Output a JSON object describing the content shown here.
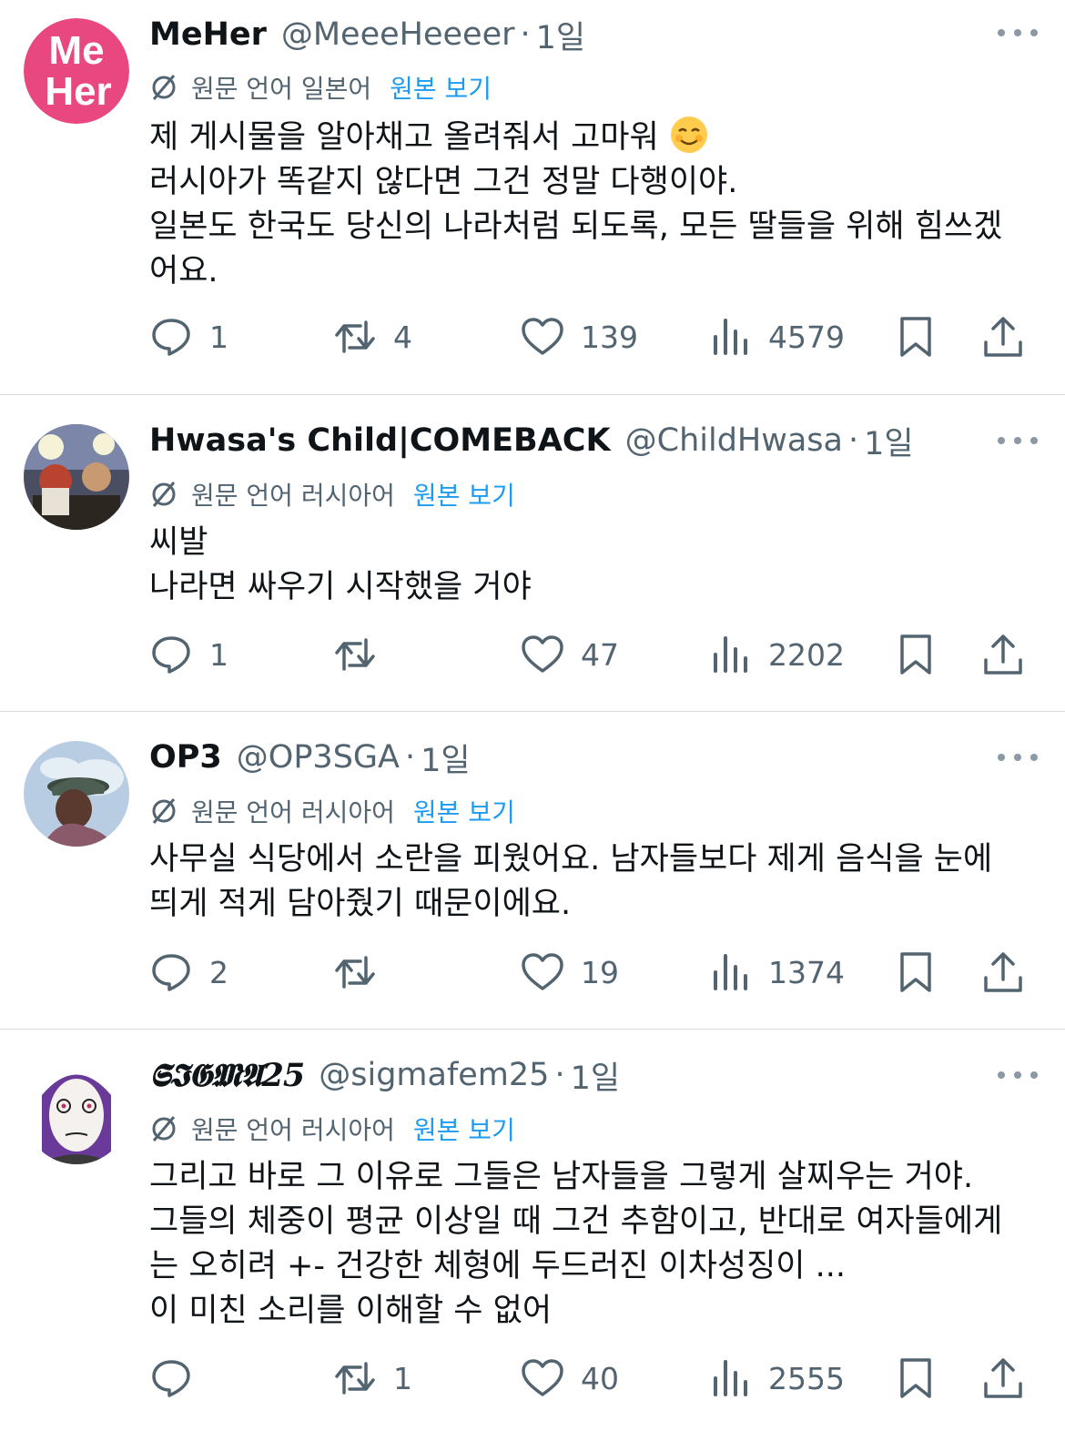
{
  "tweets": [
    {
      "display_name": "MeHer",
      "handle": "@MeeeHeeeer",
      "separator": "·",
      "time": "1일",
      "avatar_text_1": "Me",
      "avatar_text_2": "Her",
      "translate_label": "원문 언어 일본어",
      "translate_link": "원본 보기",
      "lines": [
        "제 게시물을 알아채고 올려줘서 고마워",
        "러시아가 똑같지 않다면 그건 정말 다행이야.",
        "일본도 한국도 당신의 나라처럼 되도록, 모든 딸들을 위해 힘쓰겠",
        "어요."
      ],
      "emoji": "smiling-face-emoji",
      "reply_count": "1",
      "retweet_count": "4",
      "like_count": "139",
      "view_count": "4579"
    },
    {
      "display_name": "Hwasa's Child|COMEBACK",
      "handle": "@ChildHwasa",
      "separator": "·",
      "time": "1일",
      "translate_label": "원문 언어 러시아어",
      "translate_link": "원본 보기",
      "lines": [
        "씨발",
        "나라면 싸우기 시작했을 거야"
      ],
      "reply_count": "1",
      "retweet_count": "",
      "like_count": "47",
      "view_count": "2202"
    },
    {
      "display_name": "OP3",
      "handle": "@OP3SGA",
      "separator": "·",
      "time": "1일",
      "translate_label": "원문 언어 러시아어",
      "translate_link": "원본 보기",
      "lines": [
        "사무실 식당에서 소란을 피웠어요. 남자들보다 제게 음식을 눈에",
        "띄게 적게 담아줬기 때문이에요."
      ],
      "reply_count": "2",
      "retweet_count": "",
      "like_count": "19",
      "view_count": "1374"
    },
    {
      "display_name": "𝕾𝕴𝕲𝕸𝕬25",
      "handle": "@sigmafem25",
      "separator": "·",
      "time": "1일",
      "translate_label": "원문 언어 러시아어",
      "translate_link": "원본 보기",
      "lines": [
        "그리고 바로 그 이유로 그들은 남자들을 그렇게 살찌우는 거야.",
        "그들의 체중이 평균 이상일 때 그건 추함이고, 반대로 여자들에게",
        "는 오히려 +- 건강한 체형에 두드러진 이차성징이 ...",
        "이 미친 소리를 이해할 수 없어"
      ],
      "reply_count": "",
      "retweet_count": "1",
      "like_count": "40",
      "view_count": "2555"
    }
  ],
  "colors": {
    "text": "#0f1419",
    "secondary": "#536471",
    "link": "#1d9bf0",
    "divider": "#d6d9db",
    "meher_avatar_bg": "#e8477f"
  }
}
